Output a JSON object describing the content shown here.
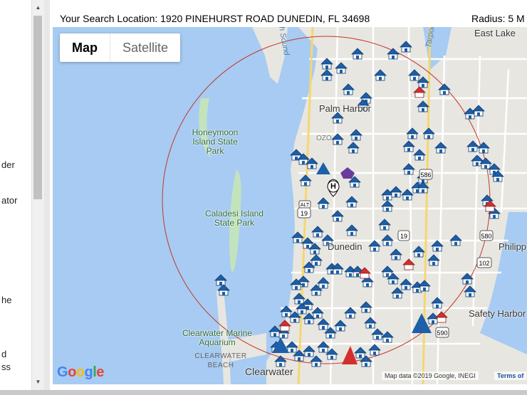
{
  "sidebar": {
    "fragments": [
      "der",
      "ator",
      "he",
      "d",
      "ss"
    ]
  },
  "header": {
    "location_text": "Your Search Location: 1920 PINEHURST ROAD DUNEDIN, FL 34698",
    "radius_text": "Radius: 5 M"
  },
  "map_controls": {
    "map_label": "Map",
    "satellite_label": "Satellite",
    "active": "Map"
  },
  "map_labels": {
    "honeymoon": "Honeymoon Island State Park",
    "caladesi": "Caladesi Island State Park",
    "palm_harbor": "Palm Harbor",
    "dunedin": "Dunedin",
    "clearwater_aquarium": "Clearwater Marine Aquarium",
    "clearwater_beach": "CLEARWATER BEACH",
    "clearwater": "Clearwater",
    "safety_harbor": "Safety Harbor",
    "east_lake": "East Lake",
    "philippe": "Philipp",
    "sound": "ph Sound",
    "lake_tarpon": "Tarpon",
    "ozona": "OZO"
  },
  "road_shields": [
    "19",
    "ALT 19",
    "586",
    "580",
    "102",
    "590",
    "19",
    "ALT"
  ],
  "home_marker_label": "H",
  "colors": {
    "water": "#a7cbf2",
    "land": "#e8e6e1",
    "park": "#c3e3bd",
    "radius_circle": "#c0392b",
    "marker_blue": "#1d5fa8",
    "marker_red": "#d32f2f",
    "marker_purple": "#6a3d9a"
  },
  "footer": {
    "google": "Google",
    "attribution": "Map data ©2019 Google, INEGI",
    "terms": "Terms of"
  }
}
